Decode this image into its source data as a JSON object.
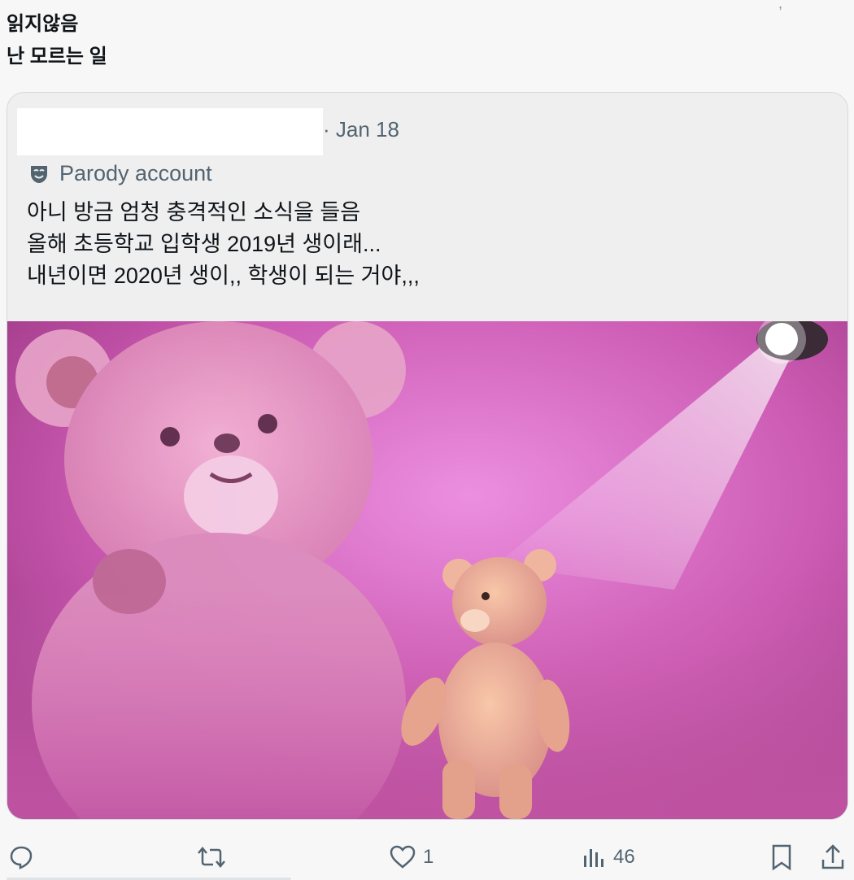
{
  "tweet": {
    "lines": [
      "읽지않음",
      "난 모르는 일"
    ]
  },
  "quote": {
    "date": "· Jan 18",
    "label": "Parody account",
    "lines": [
      "아니 방금 엄청 충격적인 소식을 들음",
      "올해 초등학교 입학생 2019년 생이래...",
      "내년이면 2020년 생이,, 학생이 되는 거야,,,"
    ]
  },
  "actions": {
    "reply_icon": "reply-icon",
    "retweet_icon": "retweet-icon",
    "like_icon": "heart-icon",
    "likes": "1",
    "views_icon": "views-icon",
    "views": "46",
    "bookmark_icon": "bookmark-icon",
    "share_icon": "share-icon"
  },
  "colors": {
    "muted": "#536471",
    "text": "#0f1419",
    "border": "#cfd9de",
    "card_bg": "#efefef"
  }
}
